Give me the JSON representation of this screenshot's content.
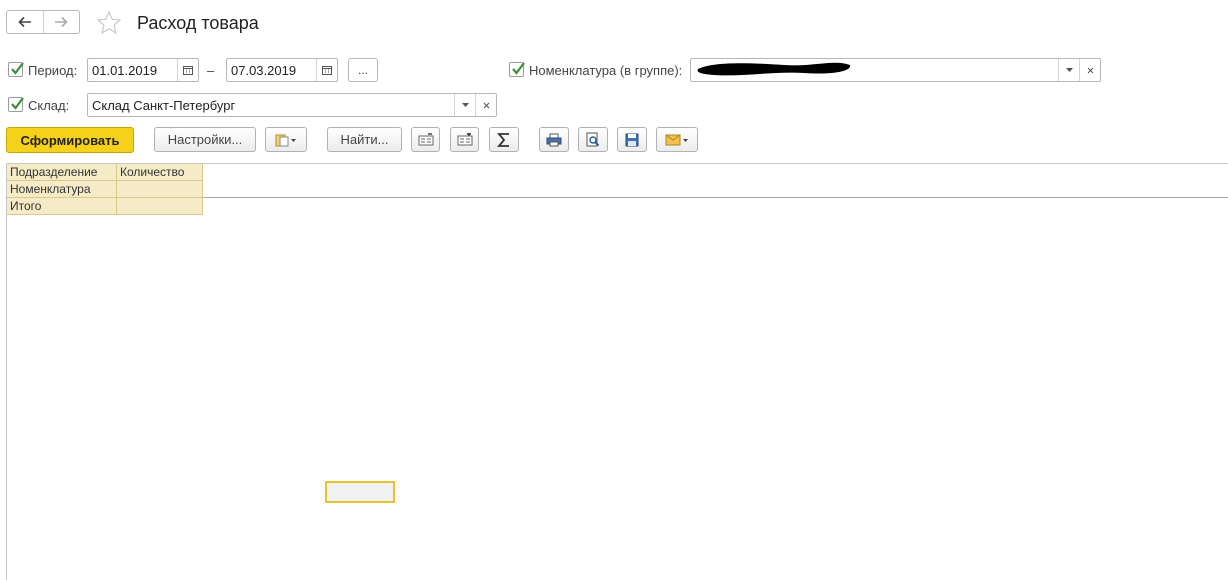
{
  "window": {
    "title": "Расход товара"
  },
  "filters": {
    "period": {
      "label": "Период:",
      "checked": true,
      "date_from": "01.01.2019",
      "date_to": "07.03.2019",
      "separator": "–",
      "more_button": "..."
    },
    "warehouse": {
      "label": "Склад:",
      "checked": true,
      "value": "Склад Санкт-Петербург"
    },
    "nomenclature": {
      "label": "Номенклатура (в группе):",
      "checked": true,
      "value": ""
    }
  },
  "toolbar": {
    "generate_label": "Сформировать",
    "settings_label": "Настройки...",
    "find_label": "Найти..."
  },
  "report": {
    "header_row1": [
      "Подразделение",
      "Количество"
    ],
    "header_row2": [
      "Номенклатура",
      ""
    ],
    "total_row": [
      "Итого",
      ""
    ]
  },
  "colors": {
    "primary_button": "#f5d11b",
    "report_header_bg": "#f5ebc6",
    "checkbox_mark": "#3a8f3a"
  },
  "icons": [
    "back-arrow-icon",
    "forward-arrow-icon",
    "favorite-star-icon",
    "calendar-icon",
    "dropdown-arrow-icon",
    "clear-icon",
    "variants-icon",
    "collapse-groups-icon",
    "expand-groups-icon",
    "sum-icon",
    "print-icon",
    "preview-icon",
    "save-icon",
    "mail-icon"
  ]
}
